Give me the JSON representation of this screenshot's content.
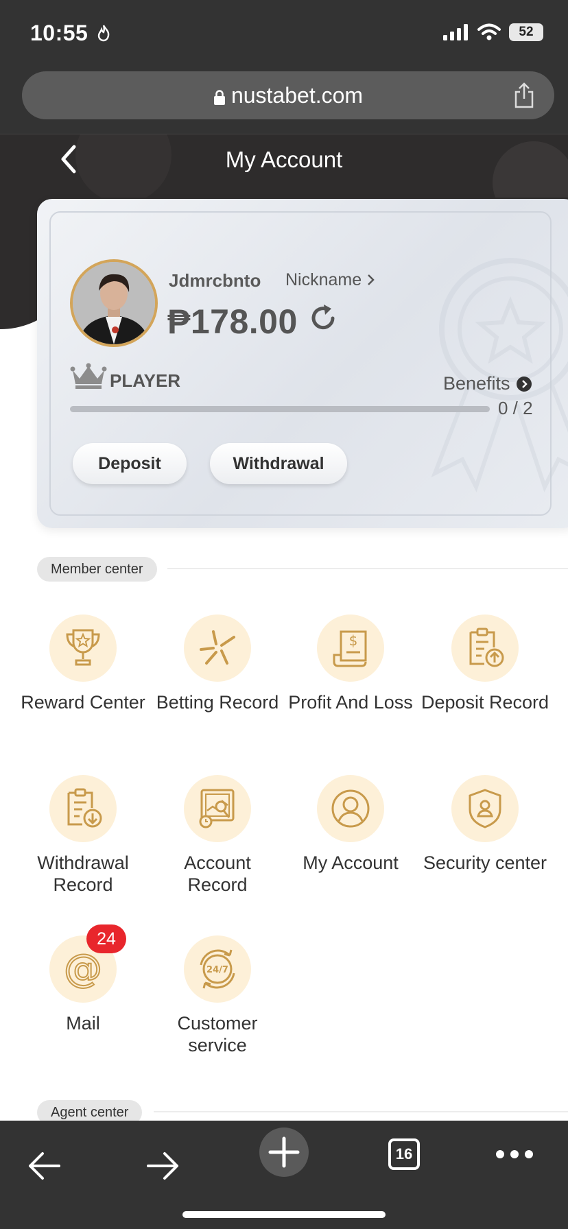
{
  "status": {
    "time": "10:55",
    "battery": "52"
  },
  "browser": {
    "url": "nustabet.com",
    "tab_count": "16"
  },
  "header": {
    "title": "My Account"
  },
  "account": {
    "username": "Jdmrcbnto",
    "nickname_label": "Nickname",
    "balance": "₱178.00",
    "level": "PLAYER",
    "benefits_label": "Benefits",
    "progress_text": "0 / 2",
    "progress_fraction": 0,
    "deposit_label": "Deposit",
    "withdrawal_label": "Withdrawal"
  },
  "member_center": {
    "title": "Member center",
    "items": [
      {
        "label": "Reward Center",
        "icon": "trophy-icon"
      },
      {
        "label": "Betting Record",
        "icon": "betting-record-icon"
      },
      {
        "label": "Profit And Loss",
        "icon": "profit-loss-icon"
      },
      {
        "label": "Deposit Record",
        "icon": "deposit-record-icon"
      },
      {
        "label": "Withdrawal Record",
        "icon": "withdrawal-record-icon"
      },
      {
        "label": "Account Record",
        "icon": "account-record-icon"
      },
      {
        "label": "My Account",
        "icon": "user-icon"
      },
      {
        "label": "Security center",
        "icon": "shield-icon"
      },
      {
        "label": "Mail",
        "icon": "mail-icon",
        "badge": "24"
      },
      {
        "label": "Customer service",
        "icon": "customer-service-icon"
      }
    ]
  },
  "agent_center": {
    "title": "Agent center"
  },
  "colors": {
    "accent_gold": "#d3a55a",
    "icon_bg": "#fdf0d8",
    "badge_red": "#e8262c",
    "dark": "#2e2c2c"
  }
}
